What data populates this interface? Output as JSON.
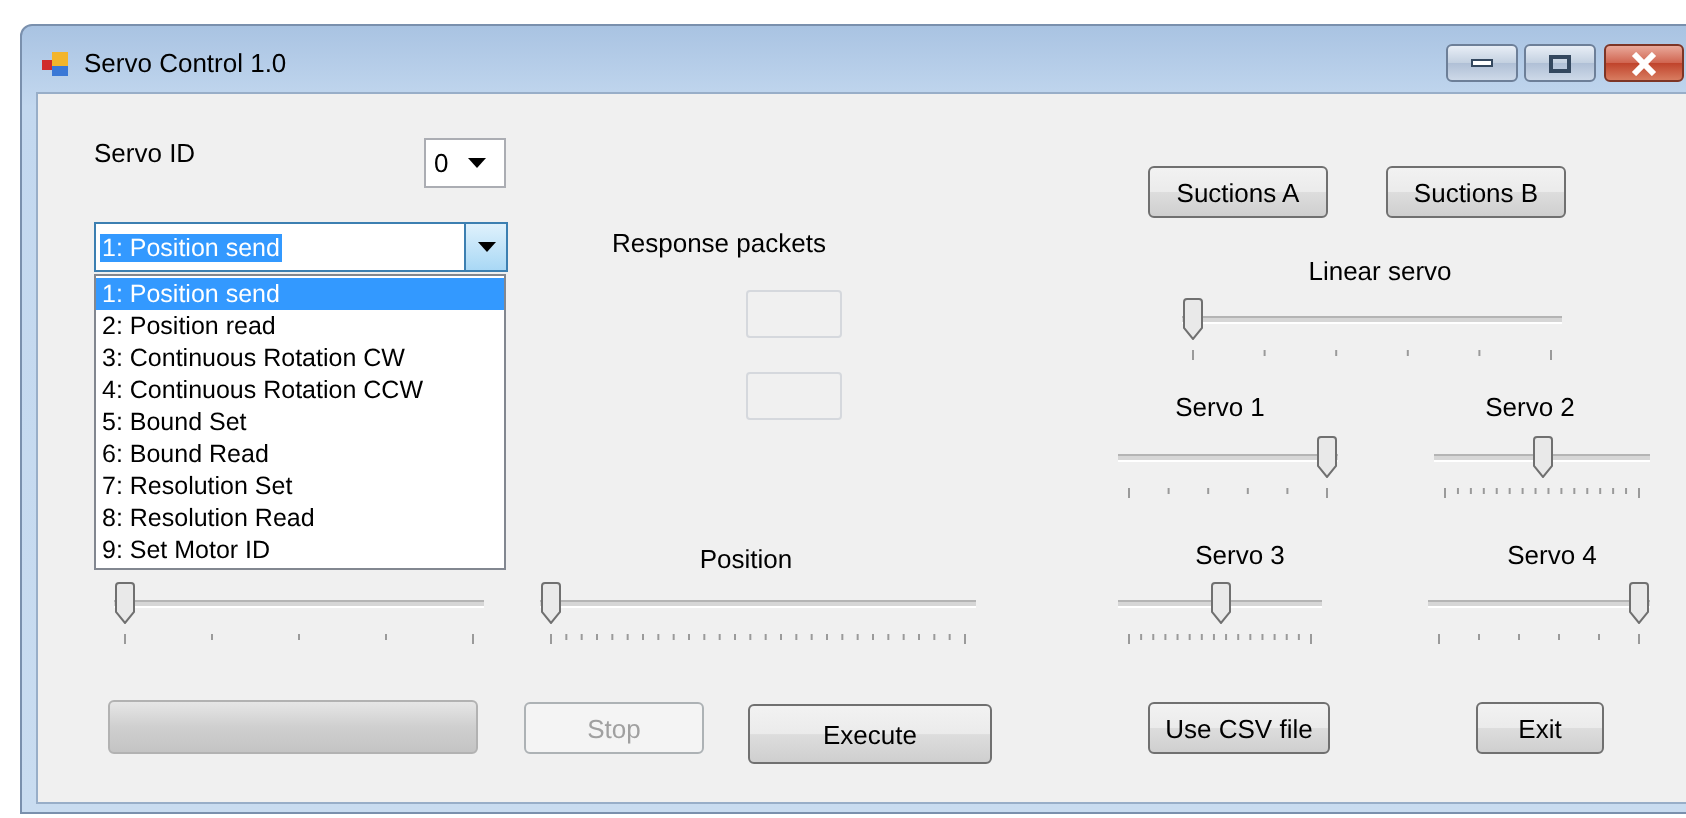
{
  "window": {
    "title": "Servo Control 1.0"
  },
  "servo_id": {
    "label": "Servo ID",
    "value": "0"
  },
  "command": {
    "value": "1: Position send",
    "expanded": true,
    "options": [
      {
        "label": "1: Position send",
        "selected": true
      },
      {
        "label": "2: Position read",
        "selected": false
      },
      {
        "label": "3: Continuous Rotation CW",
        "selected": false
      },
      {
        "label": "4: Continuous Rotation CCW",
        "selected": false
      },
      {
        "label": "5: Bound Set",
        "selected": false
      },
      {
        "label": "6: Bound Read",
        "selected": false
      },
      {
        "label": "7: Resolution Set",
        "selected": false
      },
      {
        "label": "8: Resolution Read",
        "selected": false
      },
      {
        "label": "9: Set Motor ID",
        "selected": false
      }
    ]
  },
  "response": {
    "label": "Response packets"
  },
  "suction_buttons": [
    {
      "label": "Suctions A"
    },
    {
      "label": "Suctions B"
    }
  ],
  "sliders": [
    {
      "label": "Linear servo",
      "level": 0
    },
    {
      "label": "Servo 1",
      "level": 1
    },
    {
      "label": "Servo 2",
      "level": 0.5
    },
    {
      "level": 0
    },
    {
      "label": "Position",
      "level": 0
    },
    {
      "label": "Servo 3",
      "level": 0.5
    },
    {
      "label": "Servo 4",
      "level": 1
    }
  ],
  "progress": {
    "level": 0
  },
  "buttons": [
    {
      "label": "Stop",
      "disabled": true
    },
    {
      "label": "Execute",
      "disabled": false
    },
    {
      "label": "Use CSV file",
      "disabled": false
    },
    {
      "label": "Exit",
      "disabled": false
    }
  ]
}
